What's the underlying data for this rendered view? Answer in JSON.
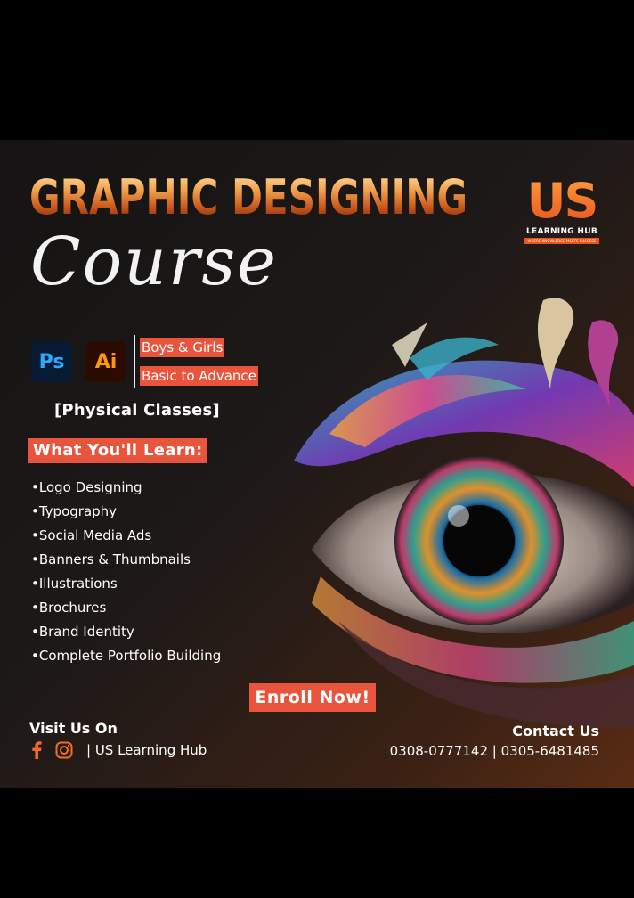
{
  "headline": {
    "title": "GRAPHIC DESIGNING",
    "subtitle": "Course"
  },
  "brand": {
    "logo_text": "US",
    "name": "LEARNING HUB",
    "tagline": "WHERE KNOWLEDGE MEETS SUCCESS",
    "accent_color": "#e8543c"
  },
  "software": [
    {
      "label": "Ps",
      "icon": "photoshop-icon"
    },
    {
      "label": "Ai",
      "icon": "illustrator-icon"
    }
  ],
  "tags": [
    "Boys & Girls",
    "Basic to Advance"
  ],
  "class_type": "[Physical Classes]",
  "learn": {
    "heading": "What You'll Learn:",
    "items": [
      "•Logo Designing",
      "•Typography",
      "•Social Media Ads",
      "•Banners & Thumbnails",
      "•Illustrations",
      "•Brochures",
      "•Brand Identity",
      "•Complete Portfolio Building"
    ]
  },
  "cta": "Enroll Now!",
  "social": {
    "heading": "Visit Us On",
    "handle": "| US Learning Hub",
    "icons": [
      "facebook-icon",
      "instagram-icon"
    ]
  },
  "contact": {
    "heading": "Contact Us",
    "phones": "0308-0777142 | 0305-6481485"
  }
}
